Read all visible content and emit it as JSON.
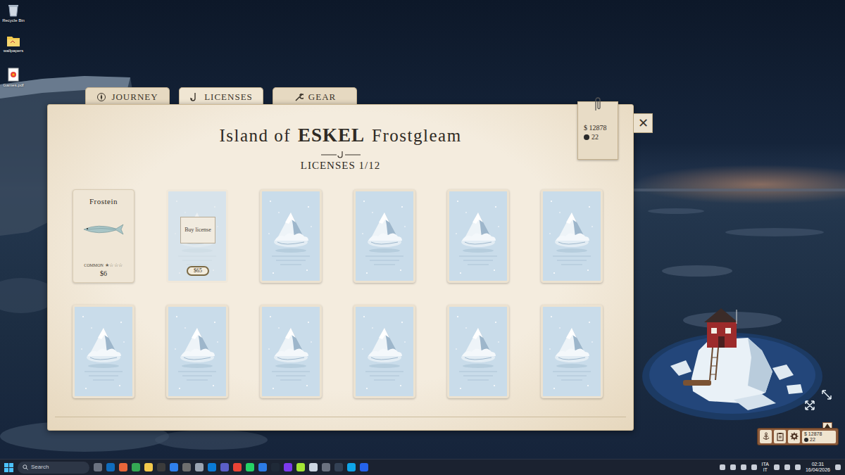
{
  "desktop_icons": [
    {
      "label": "Recycle Bin"
    },
    {
      "label": "wallpapers"
    },
    {
      "label": "Games.pdf"
    }
  ],
  "game": {
    "tabs": [
      {
        "label": "JOURNEY",
        "selected": false
      },
      {
        "label": "LICENSES",
        "selected": true
      },
      {
        "label": "GEAR",
        "selected": false
      }
    ],
    "wallet": {
      "currency": "$",
      "money": "12878",
      "pearls": "22"
    },
    "close": "✕",
    "title": {
      "prefix": "Island of",
      "name": "ESKEL",
      "suffix": "Frostgleam"
    },
    "subtitle": "LICENSES 1/12",
    "licenses": [
      {
        "kind": "owned",
        "name": "Frostein",
        "rarity": "COMMON",
        "stars": 1,
        "price": "$6"
      },
      {
        "kind": "buyable",
        "action": "Buy license",
        "price": "$65"
      },
      {
        "kind": "locked"
      },
      {
        "kind": "locked"
      },
      {
        "kind": "locked"
      },
      {
        "kind": "locked"
      },
      {
        "kind": "locked"
      },
      {
        "kind": "locked"
      },
      {
        "kind": "locked"
      },
      {
        "kind": "locked"
      },
      {
        "kind": "locked"
      },
      {
        "kind": "locked"
      }
    ]
  },
  "hud": {
    "currency": "$",
    "money": "12878",
    "pearls": "22"
  },
  "taskbar": {
    "search": "Search",
    "language": "ITA",
    "layout": "IT",
    "time": "02:31",
    "date": "16/04/2026"
  }
}
